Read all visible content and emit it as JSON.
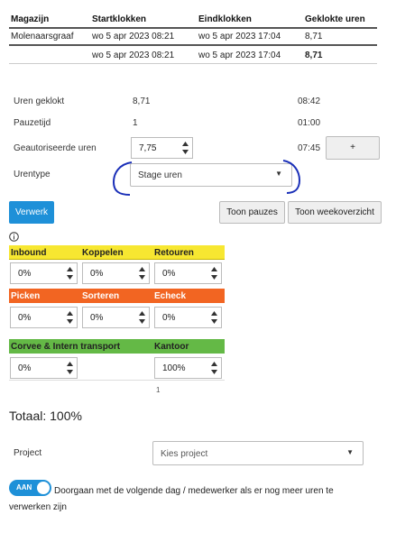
{
  "table": {
    "headers": [
      "Magazijn",
      "Startklokken",
      "Eindklokken",
      "Geklokte uren"
    ],
    "rows": [
      [
        "Molenaarsgraaf",
        "wo 5 apr 2023 08:21",
        "wo 5 apr 2023 17:04",
        "8,71"
      ],
      [
        "",
        "wo 5 apr 2023 08:21",
        "wo 5 apr 2023 17:04",
        "8,71"
      ]
    ]
  },
  "summary": {
    "uren_label": "Uren geklokt",
    "uren_value": "8,71",
    "uren_time": "08:42",
    "pauze_label": "Pauzetijd",
    "pauze_value": "1",
    "pauze_time": "01:00",
    "geaut_label": "Geautoriseerde uren",
    "geaut_value": "7,75",
    "geaut_time": "07:45",
    "plus_label": "+",
    "urentype_label": "Urentype",
    "urentype_value": "Stage uren"
  },
  "buttons": {
    "verwerk": "Verwerk",
    "toon_pauzes": "Toon pauzes",
    "toon_week": "Toon weekoverzicht"
  },
  "info_icon": "info-icon",
  "groups": [
    {
      "color": "#f7e731",
      "headers": [
        "Inbound",
        "Koppelen",
        "Retouren"
      ],
      "values": [
        "0%",
        "0%",
        "0%"
      ]
    },
    {
      "color": "#f26522",
      "headers": [
        "Picken",
        "Sorteren",
        "Echeck"
      ],
      "values": [
        "0%",
        "0%",
        "0%"
      ]
    },
    {
      "color": "#64b946",
      "headers": [
        "Corvee & Intern transport",
        "Kantoor"
      ],
      "values": [
        "0%",
        "100%"
      ]
    }
  ],
  "footnote": "1",
  "totaal": "Totaal: 100%",
  "project": {
    "label": "Project",
    "placeholder": "Kies project"
  },
  "toggle": {
    "state": "AAN",
    "text": "Doorgaan met de volgende dag / medewerker als er nog meer uren te verwerken zijn"
  },
  "annotation_color": "#1a2fb8",
  "accent": "#1e90d8"
}
